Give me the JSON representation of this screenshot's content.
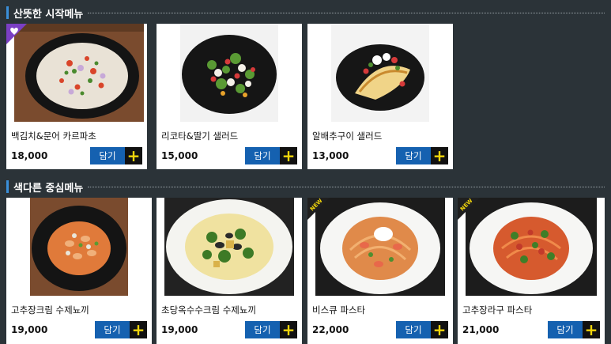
{
  "sections": [
    {
      "title": "산뜻한 시작메뉴",
      "items": [
        {
          "name": "백김치&문어 카르파초",
          "price": "18,000",
          "button": "담기",
          "plus": "+",
          "badge": "heart"
        },
        {
          "name": "리코타&딸기 샐러드",
          "price": "15,000",
          "button": "담기",
          "plus": "+",
          "badge": ""
        },
        {
          "name": "알배추구이 샐러드",
          "price": "13,000",
          "button": "담기",
          "plus": "+",
          "badge": ""
        }
      ]
    },
    {
      "title": "색다른 중심메뉴",
      "items": [
        {
          "name": "고추장크림 수제뇨끼",
          "price": "19,000",
          "button": "담기",
          "plus": "+",
          "badge": ""
        },
        {
          "name": "초당옥수수크림 수제뇨끼",
          "price": "19,000",
          "button": "담기",
          "plus": "+",
          "badge": ""
        },
        {
          "name": "비스큐 파스타",
          "price": "22,000",
          "button": "담기",
          "plus": "+",
          "badge": "NEW"
        },
        {
          "name": "고추장라구 파스타",
          "price": "21,000",
          "button": "담기",
          "plus": "+",
          "badge": "NEW"
        }
      ]
    }
  ],
  "colors": {
    "background": "#2b3338",
    "button": "#1561b0",
    "plus_bg": "#111111",
    "plus_fg": "#f2d60b",
    "heart_badge": "#7b3fc4",
    "new_badge": "#1f1f1f"
  }
}
